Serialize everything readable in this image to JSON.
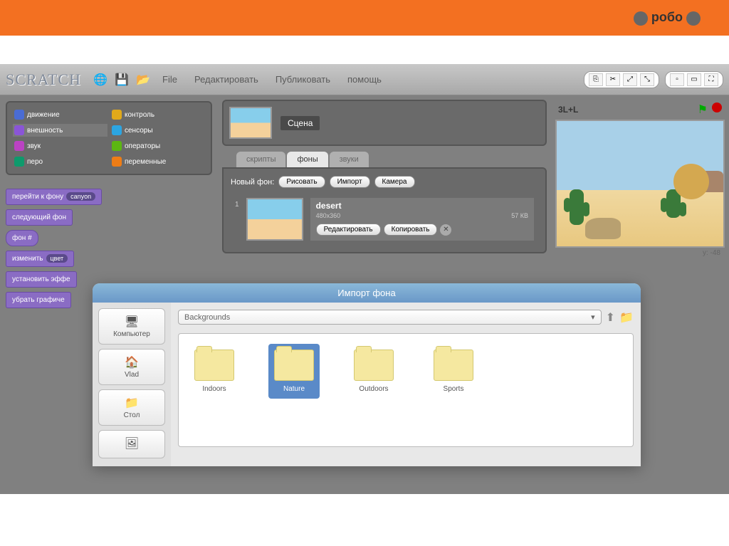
{
  "header": {
    "logo_text": "робо"
  },
  "toolbar": {
    "app_title": "SCRATCH",
    "menu": {
      "file": "File",
      "edit": "Редактировать",
      "share": "Публиковать",
      "help": "помощь"
    }
  },
  "categories": {
    "motion": "движение",
    "control": "контроль",
    "looks": "внешность",
    "sensing": "сенсоры",
    "sound": "звук",
    "operators": "операторы",
    "pen": "перо",
    "variables": "переменные"
  },
  "category_colors": {
    "motion": "#4a6cd4",
    "control": "#e1a91a",
    "looks": "#8a55d7",
    "sensing": "#2ca5e2",
    "sound": "#bb42c3",
    "operators": "#5cb712",
    "pen": "#0e9a6c",
    "variables": "#ee7d16"
  },
  "blocks": {
    "switch_bg": "перейти к фону",
    "switch_bg_param": "canyon",
    "next_bg": "следующий фон",
    "bg_num": "фон #",
    "change_effect": "изменить",
    "change_effect_param": "цвет",
    "set_effect": "установить эффе",
    "clear_effects": "убрать графиче"
  },
  "sprite": {
    "name": "Сцена"
  },
  "tabs": {
    "scripts": "скрипты",
    "backgrounds": "фоны",
    "sounds": "звуки"
  },
  "bg_panel": {
    "new_label": "Новый фон:",
    "paint": "Рисовать",
    "import": "Импорт",
    "camera": "Камера",
    "item_num": "1",
    "item_name": "desert",
    "item_dims": "480x360",
    "item_size": "57 КВ",
    "edit": "Редактировать",
    "copy": "Копировать"
  },
  "stage": {
    "title": "3L+L",
    "coords": "y: -48"
  },
  "dialog": {
    "title": "Импорт фона",
    "sidebar": {
      "computer": "Компьютер",
      "user": "Vlad",
      "desktop": "Стол"
    },
    "path": "Backgrounds",
    "folders": {
      "indoors": "Indoors",
      "nature": "Nature",
      "outdoors": "Outdoors",
      "sports": "Sports"
    }
  }
}
